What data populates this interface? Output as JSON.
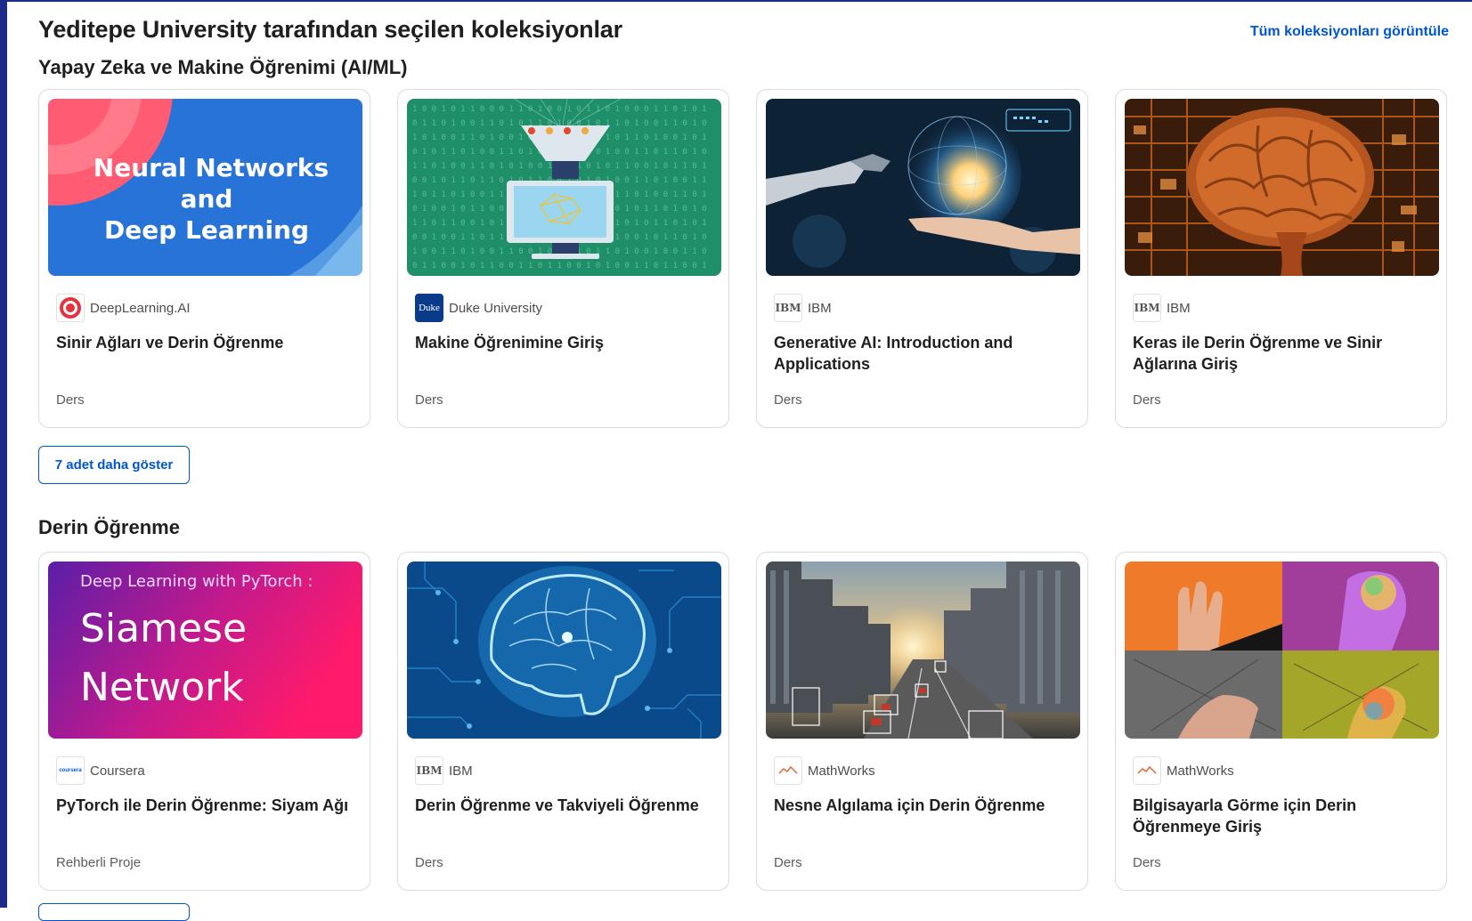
{
  "page_title": "Yeditepe University tarafından seçilen koleksiyonlar",
  "view_all_label": "Tüm koleksiyonları görüntüle",
  "sections": [
    {
      "title": "Yapay Zeka ve Makine Öğrenimi (AI/ML)",
      "show_more_label": "7 adet daha göster",
      "cards": [
        {
          "partner": "DeepLearning.AI",
          "title": "Sinir Ağları ve Derin Öğrenme",
          "type": "Ders",
          "thumb_text": [
            "Neural Networks",
            "and",
            "Deep Learning"
          ]
        },
        {
          "partner": "Duke University",
          "logo_text": "Duke",
          "title": "Makine Öğrenimine Giriş",
          "type": "Ders"
        },
        {
          "partner": "IBM",
          "logo_text": "IBM",
          "title": "Generative AI: Introduction and Applications",
          "type": "Ders"
        },
        {
          "partner": "IBM",
          "logo_text": "IBM",
          "title": "Keras ile Derin Öğrenme ve Sinir Ağlarına Giriş",
          "type": "Ders"
        }
      ]
    },
    {
      "title": "Derin Öğrenme",
      "cards": [
        {
          "partner": "Coursera",
          "logo_text": "coursera",
          "title": "PyTorch ile Derin Öğrenme: Siyam Ağı",
          "type": "Rehberli Proje",
          "thumb_text": [
            "Deep Learning with PyTorch :",
            "Siamese",
            "Network"
          ]
        },
        {
          "partner": "IBM",
          "logo_text": "IBM",
          "title": "Derin Öğrenme ve Takviyeli Öğrenme",
          "type": "Ders"
        },
        {
          "partner": "MathWorks",
          "title": "Nesne Algılama için Derin Öğrenme",
          "type": "Ders"
        },
        {
          "partner": "MathWorks",
          "title": "Bilgisayarla Görme için Derin Öğrenmeye Giriş",
          "type": "Ders"
        }
      ]
    }
  ]
}
